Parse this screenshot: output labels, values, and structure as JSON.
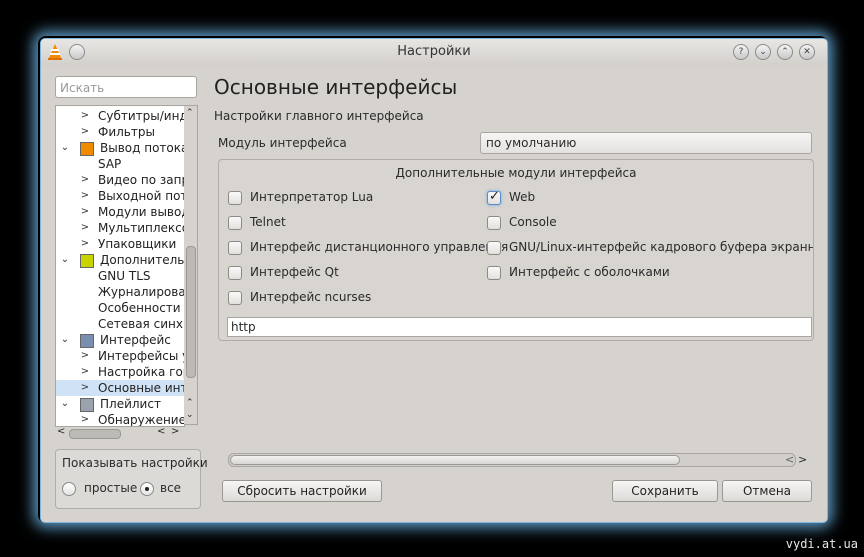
{
  "window": {
    "title": "Настройки"
  },
  "titlebar_buttons": [
    "?",
    "⌄",
    "⌃",
    "✕"
  ],
  "search": {
    "placeholder": "Искать"
  },
  "tree": {
    "items": [
      {
        "label": "Субтитры/инди",
        "arrow": ">",
        "indent": 2
      },
      {
        "label": "Фильтры",
        "arrow": ">",
        "indent": 2
      },
      {
        "label": "Вывод потока",
        "arrow": "⌄",
        "indent": 1,
        "icon": "stream-output-icon"
      },
      {
        "label": "SAP",
        "arrow": "",
        "indent": 2
      },
      {
        "label": "Видео по запро",
        "arrow": ">",
        "indent": 2
      },
      {
        "label": "Выходной пото",
        "arrow": ">",
        "indent": 2
      },
      {
        "label": "Модули вывод",
        "arrow": ">",
        "indent": 2
      },
      {
        "label": "Мультиплексор",
        "arrow": ">",
        "indent": 2
      },
      {
        "label": "Упаковщики",
        "arrow": ">",
        "indent": 2
      },
      {
        "label": "Дополнительн",
        "arrow": "⌄",
        "indent": 1,
        "icon": "chip-icon"
      },
      {
        "label": "GNU TLS",
        "arrow": "",
        "indent": 2
      },
      {
        "label": "Журналирован",
        "arrow": "",
        "indent": 2
      },
      {
        "label": "Особенности С",
        "arrow": "",
        "indent": 2
      },
      {
        "label": "Сетевая синхро",
        "arrow": "",
        "indent": 2
      },
      {
        "label": "Интерфейс",
        "arrow": "⌄",
        "indent": 1,
        "icon": "interface-icon"
      },
      {
        "label": "Интерфейсы уп",
        "arrow": ">",
        "indent": 2
      },
      {
        "label": "Настройка горя",
        "arrow": ">",
        "indent": 2
      },
      {
        "label": "Основные инте",
        "arrow": ">",
        "indent": 2,
        "selected": true
      },
      {
        "label": "Плейлист",
        "arrow": "⌄",
        "indent": 1,
        "icon": "playlist-icon"
      },
      {
        "label": "Обнаружение с",
        "arrow": ">",
        "indent": 2
      }
    ]
  },
  "show_settings": {
    "title": "Показывать настройки",
    "simple": "простые",
    "all": "все"
  },
  "panel": {
    "title": "Основные интерфейсы",
    "section": "Настройки главного интерфейса",
    "module_label": "Модуль интерфейса",
    "module_value": "по умолчанию",
    "extra_title": "Дополнительные модули интерфейса",
    "checkboxes_left": [
      {
        "label": "Интерпретатор Lua",
        "checked": false
      },
      {
        "label": "Telnet",
        "checked": false
      },
      {
        "label": "Интерфейс дистанционного управления",
        "checked": false
      },
      {
        "label": "Интерфейс Qt",
        "checked": false
      },
      {
        "label": "Интерфейс ncurses",
        "checked": false
      }
    ],
    "checkboxes_right": [
      {
        "label": "Web",
        "checked": true
      },
      {
        "label": "Console",
        "checked": false
      },
      {
        "label": "GNU/Linux-интерфейс кадрового буфера экранной и",
        "checked": false
      },
      {
        "label": "Интерфейс с оболочками",
        "checked": false
      }
    ],
    "modules_text": "http"
  },
  "buttons": {
    "reset": "Сбросить настройки",
    "save": "Сохранить",
    "cancel": "Отмена"
  },
  "watermark": "vydi.at.ua",
  "colors": {
    "selection": "#cfe2f6",
    "window_bg": "#d6d3cf",
    "glow": "#78c8ff"
  }
}
